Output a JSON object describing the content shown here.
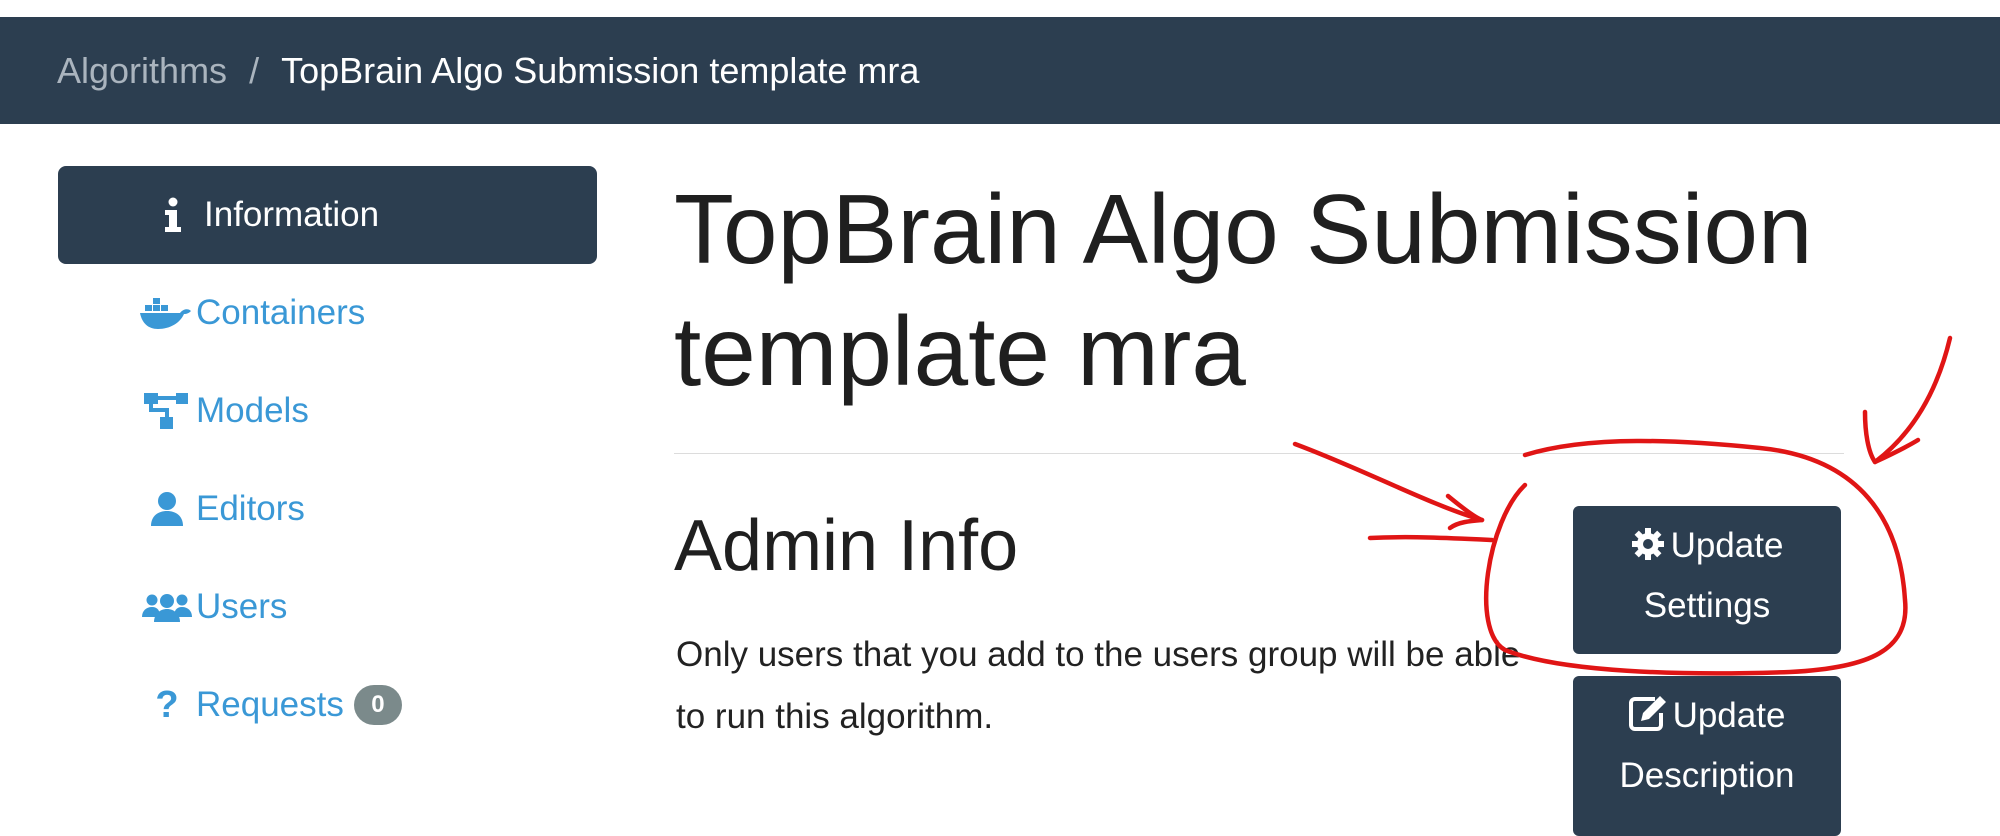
{
  "breadcrumb": {
    "root": "Algorithms",
    "separator": "/",
    "current": "TopBrain Algo Submission template mra"
  },
  "sidebar": {
    "items": [
      {
        "label": "Information",
        "icon": "info-icon",
        "active": true
      },
      {
        "label": "Containers",
        "icon": "docker-icon"
      },
      {
        "label": "Models",
        "icon": "sitemap-icon"
      },
      {
        "label": "Editors",
        "icon": "user-icon"
      },
      {
        "label": "Users",
        "icon": "users-icon"
      },
      {
        "label": "Requests",
        "icon": "question-icon",
        "badge": "0"
      }
    ]
  },
  "main": {
    "title": "TopBrain Algo Submission template mra",
    "section_title": "Admin Info",
    "section_description": "Only users that you add to the users group will be able to run this algorithm.",
    "buttons": {
      "update_settings": {
        "label": "Update Settings",
        "icon": "gear-icon"
      },
      "update_description": {
        "label": "Update Description",
        "icon": "edit-icon"
      }
    }
  },
  "colors": {
    "header_bg": "#2c3e50",
    "link": "#3a98d6",
    "badge": "#7b8a8b",
    "annotation": "#e01515"
  },
  "annotation": {
    "type": "hand-drawn red circle with arrows around Update Settings button"
  }
}
